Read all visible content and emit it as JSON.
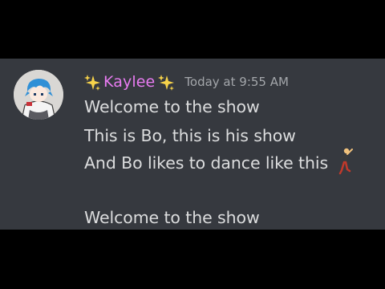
{
  "message": {
    "author": {
      "name": "Kaylee",
      "left_decoration_icon": "sparkles-icon",
      "right_decoration_icon": "sparkles-icon",
      "name_color": "#e77bf0"
    },
    "timestamp": "Today at 9:55 AM",
    "lines": [
      "Welcome to the show",
      "This is Bo, this is his show",
      "And Bo likes to dance like this",
      "Welcome to the show"
    ],
    "inline_emoji": "man-dancing-icon"
  },
  "theme": {
    "panel_background": "#36393f",
    "text_color": "#dcddde",
    "timestamp_color": "#a3a6aa"
  }
}
